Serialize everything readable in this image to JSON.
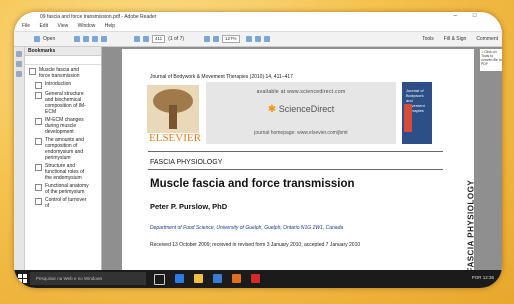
{
  "window": {
    "title": "09 fascia and force transmission.pdf - Adobe Reader",
    "controls": [
      "–",
      "□",
      "×"
    ]
  },
  "menu": [
    "File",
    "Edit",
    "View",
    "Window",
    "Help"
  ],
  "toolbar": {
    "open_label": "Open",
    "page_value": "411",
    "page_of": "(1 of 7)",
    "zoom_value": "127%",
    "right_links": [
      "Tools",
      "Fill & Sign",
      "Comment"
    ]
  },
  "help_tip": "Click on Tools to convert file to PDF",
  "bookmarks": {
    "header": "Bookmarks",
    "items": [
      {
        "label": "Muscle fascia and force transmission",
        "sub": false
      },
      {
        "label": "Introduction",
        "sub": true
      },
      {
        "label": "General structure and biochemical composition of IM-ECM",
        "sub": true
      },
      {
        "label": "IM-ECM changes during muscle development",
        "sub": true
      },
      {
        "label": "The amounts and composition of endomysium and perimysium",
        "sub": true
      },
      {
        "label": "Structure and functional roles of the endomysium",
        "sub": true
      },
      {
        "label": "Functional anatomy of the perimysium",
        "sub": true
      },
      {
        "label": "Control of turnover of",
        "sub": true
      }
    ]
  },
  "article": {
    "journal_line": "Journal of Bodywork & Movement Therapies (2010) 14, 411–417",
    "available": "available at www.sciencedirect.com",
    "sciencedirect": "ScienceDirect",
    "homepage": "journal homepage: www.elsevier.com/jbmt",
    "publisher": "ELSEVIER",
    "cover_title": "Journal of Bodywork and Movement Therapies",
    "section": "FASCIA PHYSIOLOGY",
    "title": "Muscle fascia and force transmission",
    "author": "Peter P. Purslow, PhD",
    "affiliation": "Department of Food Science, University of Guelph, Guelph, Ontario N1G 2W1, Canada",
    "received": "Received 13 October 2009; received in revised form 3 January 2010; accepted 7 January 2010",
    "side_label": "FASCIA PHYSIOLOGY"
  },
  "taskbar": {
    "search_placeholder": "Pesquisar na Web e no Windows",
    "tray": "POR 12:36"
  },
  "colors": {
    "frame": "#f5c34f",
    "elsevier": "#e87d1e",
    "affiliation": "#1a3a8a"
  }
}
